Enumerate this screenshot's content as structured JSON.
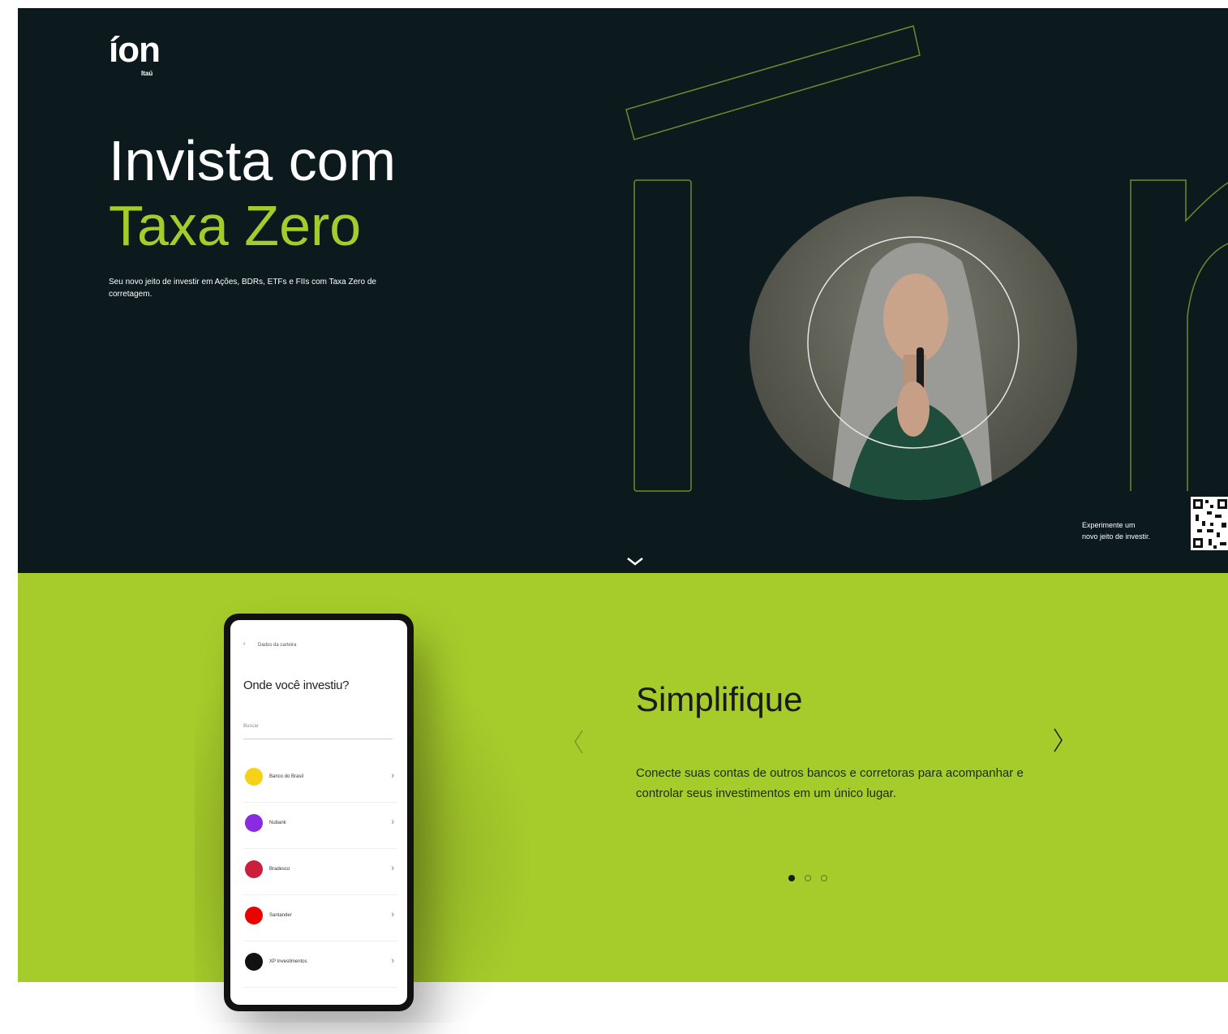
{
  "colors": {
    "hero_bg": "#0c1a1e",
    "accent": "#a6cc2b",
    "text_dark": "#1a1a1a",
    "white": "#ffffff"
  },
  "brand": {
    "logo_text": "íon",
    "logo_sub": "Itaú"
  },
  "hero": {
    "title_line1": "Invista com",
    "title_line2": "Taxa Zero",
    "subtitle": "Seu novo jeito de investir em Ações, BDRs, ETFs e FIIs com Taxa Zero de corretagem.",
    "qr_text_line1": "Experimente um",
    "qr_text_line2": "novo jeito de investir."
  },
  "phone_screen": {
    "back_label": "Dados da carteira",
    "title": "Onde você investiu?",
    "search_placeholder": "Buscar",
    "banks": [
      {
        "name": "Banco do Brasil",
        "icon": "banco-do-brasil-logo",
        "color": "#f7d117"
      },
      {
        "name": "Nubank",
        "icon": "nubank-logo",
        "color": "#8a2be2"
      },
      {
        "name": "Bradesco",
        "icon": "bradesco-logo",
        "color": "#cc1f3d"
      },
      {
        "name": "Santander",
        "icon": "santander-logo",
        "color": "#ec0000"
      },
      {
        "name": "XP Investimentos",
        "icon": "xp-logo",
        "color": "#111111"
      }
    ]
  },
  "carousel": {
    "title": "Simplifique",
    "text": "Conecte suas contas de outros bancos e corretoras para acompanhar e controlar seus investimentos em um único lugar.",
    "prev_icon": "chevron-left-icon",
    "next_icon": "chevron-right-icon",
    "active_index": 0,
    "total_slides": 3
  }
}
